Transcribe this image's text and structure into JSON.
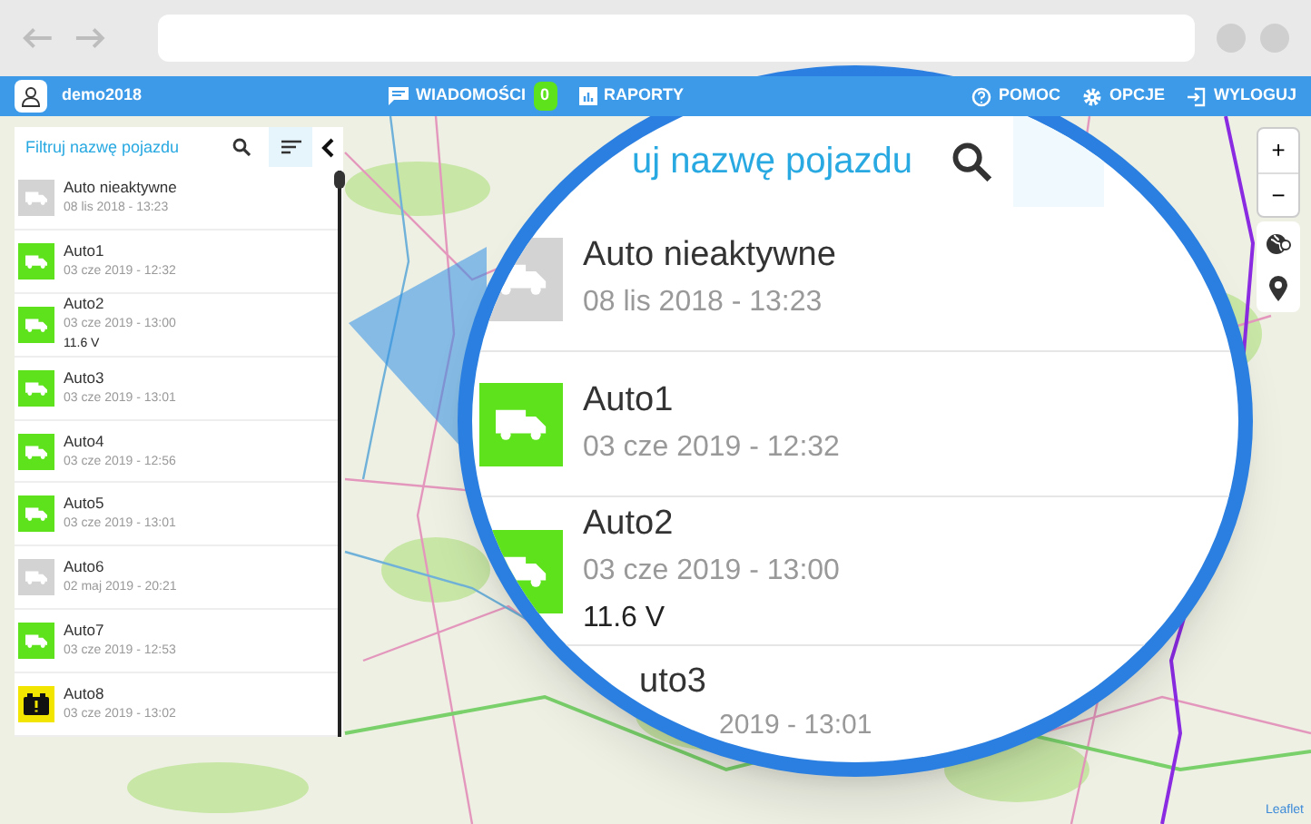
{
  "app_bar": {
    "username": "demo2018",
    "messages": {
      "label": "WIADOMOŚCI",
      "badge": "0"
    },
    "reports": {
      "label": "RAPORTY"
    },
    "help": {
      "label": "POMOC"
    },
    "options": {
      "label": "OPCJE"
    },
    "logout": {
      "label": "WYLOGUJ"
    }
  },
  "sidebar": {
    "search": {
      "placeholder": "Filtruj nazwę pojazdu"
    },
    "vehicles": [
      {
        "name": "Auto nieaktywne",
        "time": "08 lis 2018 - 13:23",
        "kind": "truck",
        "color": "#d3d3d3"
      },
      {
        "name": "Auto1",
        "time": "03 cze 2019 - 12:32",
        "kind": "truck",
        "color": "#5ee21c"
      },
      {
        "name": "Auto2",
        "time": "03 cze 2019 - 13:00",
        "voltage": "11.6 V",
        "kind": "truck",
        "color": "#5ee21c"
      },
      {
        "name": "Auto3",
        "time": "03 cze 2019 - 13:01",
        "kind": "truck",
        "color": "#5ee21c"
      },
      {
        "name": "Auto4",
        "time": "03 cze 2019 - 12:56",
        "kind": "truck",
        "color": "#5ee21c"
      },
      {
        "name": "Auto5",
        "time": "03 cze 2019 - 13:01",
        "kind": "truck",
        "color": "#5ee21c"
      },
      {
        "name": "Auto6",
        "time": "02 maj 2019 - 20:21",
        "kind": "truck",
        "color": "#d3d3d3"
      },
      {
        "name": "Auto7",
        "time": "03 cze 2019 - 12:53",
        "kind": "truck",
        "color": "#5ee21c"
      },
      {
        "name": "Auto8",
        "time": "03 cze 2019 - 13:02",
        "kind": "battery",
        "color": "#f2e600"
      }
    ]
  },
  "map": {
    "attribution": "Leaflet",
    "zoom_in": "+",
    "zoom_out": "−"
  },
  "magnifier": {
    "search_placeholder": "uj nazwę pojazdu",
    "vehicles": [
      {
        "name": "Auto nieaktywne",
        "time": "08 lis 2018 - 13:23",
        "kind": "truck",
        "color": "#d3d3d3"
      },
      {
        "name": "Auto1",
        "time": "03 cze 2019 - 12:32",
        "kind": "truck",
        "color": "#5ee21c"
      },
      {
        "name": "Auto2",
        "time": "03 cze 2019 - 13:00",
        "voltage": "11.6 V",
        "kind": "truck",
        "color": "#5ee21c"
      },
      {
        "name": "uto3",
        "time": "2019 - 13:01",
        "kind": "partial"
      }
    ]
  }
}
